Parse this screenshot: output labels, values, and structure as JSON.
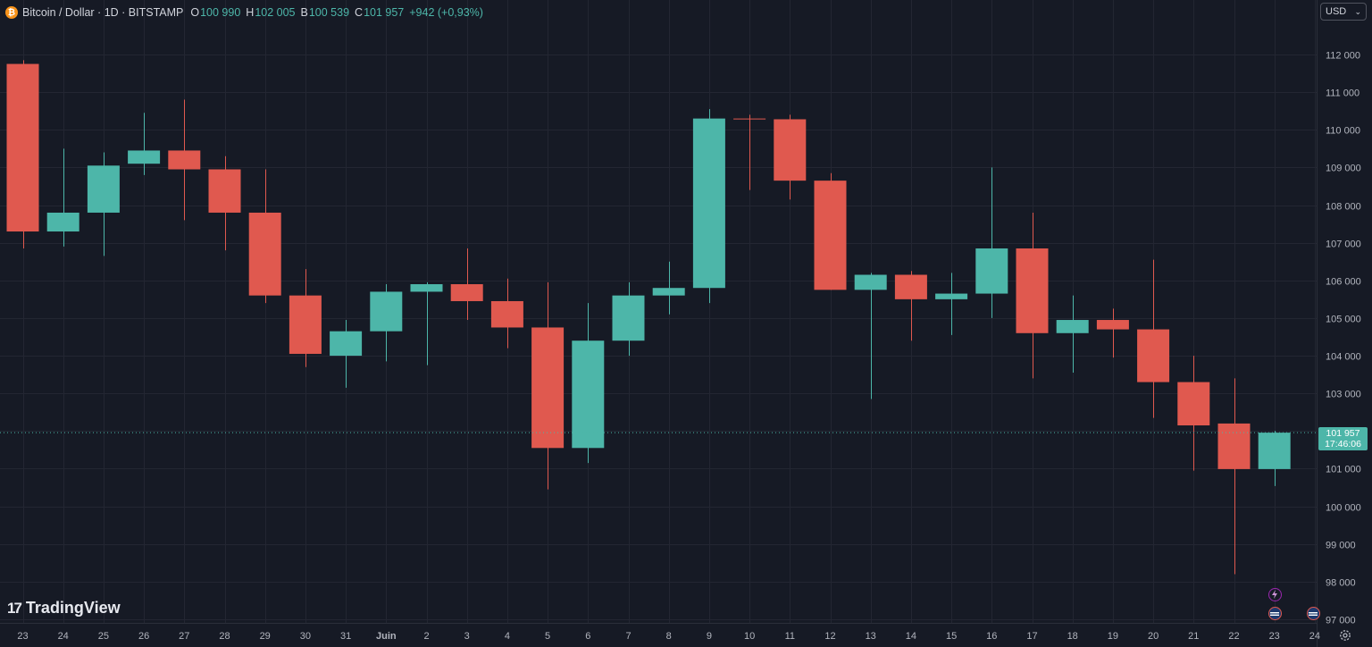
{
  "legend": {
    "coin_glyph": "₿",
    "symbol": "Bitcoin / Dollar · 1D · BITSTAMP",
    "o_label": "O",
    "o_value": "100 990",
    "h_label": "H",
    "h_value": "102 005",
    "b_label": "B",
    "b_value": "100 539",
    "c_label": "C",
    "c_value": "101 957",
    "change": "+942 (+0,93%)"
  },
  "currency_select": {
    "value": "USD",
    "chevron": "⌄"
  },
  "last_price": {
    "value": "101 957",
    "countdown": "17:46:06"
  },
  "branding": {
    "mark": "17",
    "name": "TradingView"
  },
  "colors": {
    "background": "#161a25",
    "up": "#4db6a9",
    "down": "#e0594f",
    "grid": "#232632",
    "axis_text": "#b2b5be"
  },
  "icons": {
    "settings": "gear-icon",
    "flash_event": "lightning-icon",
    "us_event": "us-flag-icon"
  },
  "chart_data": {
    "type": "candlestick",
    "ylim": [
      96800,
      112500
    ],
    "y_ticks": [
      97000,
      98000,
      99000,
      100000,
      101000,
      102000,
      103000,
      104000,
      105000,
      106000,
      107000,
      108000,
      109000,
      110000,
      111000,
      112000
    ],
    "y_tick_labels": [
      "97 000",
      "98 000",
      "99 000",
      "100 000",
      "101 000",
      "102 000",
      "103 000",
      "104 000",
      "105 000",
      "106 000",
      "107 000",
      "108 000",
      "109 000",
      "110 000",
      "111 000",
      "112 000"
    ],
    "x_labels": [
      "23",
      "24",
      "25",
      "26",
      "27",
      "28",
      "29",
      "30",
      "31",
      "Juin",
      "2",
      "3",
      "4",
      "5",
      "6",
      "7",
      "8",
      "9",
      "10",
      "11",
      "12",
      "13",
      "14",
      "15",
      "16",
      "17",
      "18",
      "19",
      "20",
      "21",
      "22",
      "23",
      "24"
    ],
    "candles": [
      {
        "x": "23",
        "o": 111750,
        "h": 111850,
        "l": 106850,
        "c": 107300
      },
      {
        "x": "24",
        "o": 107300,
        "h": 109500,
        "l": 106900,
        "c": 107800
      },
      {
        "x": "25",
        "o": 107800,
        "h": 109400,
        "l": 106650,
        "c": 109050
      },
      {
        "x": "26",
        "o": 109100,
        "h": 110450,
        "l": 108800,
        "c": 109450
      },
      {
        "x": "27",
        "o": 109450,
        "h": 110800,
        "l": 107600,
        "c": 108950
      },
      {
        "x": "28",
        "o": 108950,
        "h": 109300,
        "l": 106800,
        "c": 107800
      },
      {
        "x": "29",
        "o": 107800,
        "h": 108950,
        "l": 105400,
        "c": 105600
      },
      {
        "x": "30",
        "o": 105600,
        "h": 106300,
        "l": 103700,
        "c": 104050
      },
      {
        "x": "31",
        "o": 104000,
        "h": 104950,
        "l": 103150,
        "c": 104650
      },
      {
        "x": "Juin",
        "o": 104650,
        "h": 105900,
        "l": 103850,
        "c": 105700
      },
      {
        "x": "2",
        "o": 105700,
        "h": 105950,
        "l": 103750,
        "c": 105900
      },
      {
        "x": "3",
        "o": 105900,
        "h": 106850,
        "l": 104950,
        "c": 105450
      },
      {
        "x": "4",
        "o": 105450,
        "h": 106050,
        "l": 104200,
        "c": 104750
      },
      {
        "x": "5",
        "o": 104750,
        "h": 105950,
        "l": 100450,
        "c": 101550
      },
      {
        "x": "6",
        "o": 101550,
        "h": 105400,
        "l": 101150,
        "c": 104400
      },
      {
        "x": "7",
        "o": 104400,
        "h": 105950,
        "l": 104000,
        "c": 105600
      },
      {
        "x": "8",
        "o": 105600,
        "h": 106500,
        "l": 105100,
        "c": 105800
      },
      {
        "x": "9",
        "o": 105800,
        "h": 110550,
        "l": 105400,
        "c": 110300
      },
      {
        "x": "10",
        "o": 110300,
        "h": 110400,
        "l": 108400,
        "c": 110280
      },
      {
        "x": "11",
        "o": 110280,
        "h": 110400,
        "l": 108150,
        "c": 108650
      },
      {
        "x": "12",
        "o": 108650,
        "h": 108850,
        "l": 105750,
        "c": 105750
      },
      {
        "x": "13",
        "o": 105750,
        "h": 106200,
        "l": 102850,
        "c": 106150
      },
      {
        "x": "14",
        "o": 106150,
        "h": 106250,
        "l": 104400,
        "c": 105500
      },
      {
        "x": "15",
        "o": 105500,
        "h": 106200,
        "l": 104550,
        "c": 105650
      },
      {
        "x": "16",
        "o": 105650,
        "h": 109000,
        "l": 105000,
        "c": 106850
      },
      {
        "x": "17",
        "o": 106850,
        "h": 107800,
        "l": 103400,
        "c": 104600
      },
      {
        "x": "18",
        "o": 104600,
        "h": 105600,
        "l": 103550,
        "c": 104950
      },
      {
        "x": "19",
        "o": 104950,
        "h": 105250,
        "l": 103950,
        "c": 104700
      },
      {
        "x": "20",
        "o": 104700,
        "h": 106550,
        "l": 102350,
        "c": 103300
      },
      {
        "x": "21",
        "o": 103300,
        "h": 104000,
        "l": 100950,
        "c": 102150
      },
      {
        "x": "22",
        "o": 102200,
        "h": 103400,
        "l": 98200,
        "c": 100990
      },
      {
        "x": "23",
        "o": 100990,
        "h": 102005,
        "l": 100539,
        "c": 101957
      }
    ]
  }
}
